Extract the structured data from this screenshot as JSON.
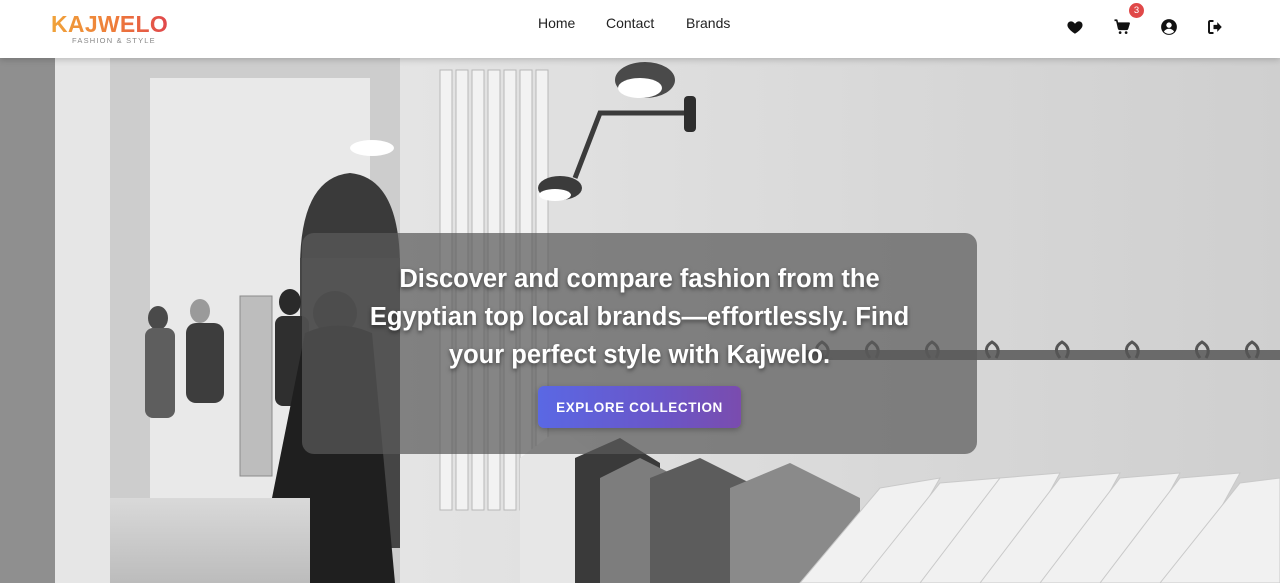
{
  "brand": {
    "name": "KAJWELO",
    "tagline": "FASHION & STYLE"
  },
  "nav": [
    {
      "label": "Home"
    },
    {
      "label": "Contact"
    },
    {
      "label": "Brands"
    }
  ],
  "header_icons": {
    "wishlist": "heart-icon",
    "cart": "cart-icon",
    "cart_count": "3",
    "account": "user-circle-icon",
    "logout": "sign-out-icon"
  },
  "hero": {
    "headline_lines": [
      "Discover and compare fashion from the",
      "Egyptian top local brands—effortlessly. Find",
      "your perfect style with Kajwelo."
    ],
    "cta_label": "EXPLORE COLLECTION"
  },
  "colors": {
    "logo_gradient": [
      "#f0a33a",
      "#e0474c"
    ],
    "badge": "#e04848",
    "cta_gradient": [
      "#5a68e4",
      "#7a4cae"
    ]
  }
}
